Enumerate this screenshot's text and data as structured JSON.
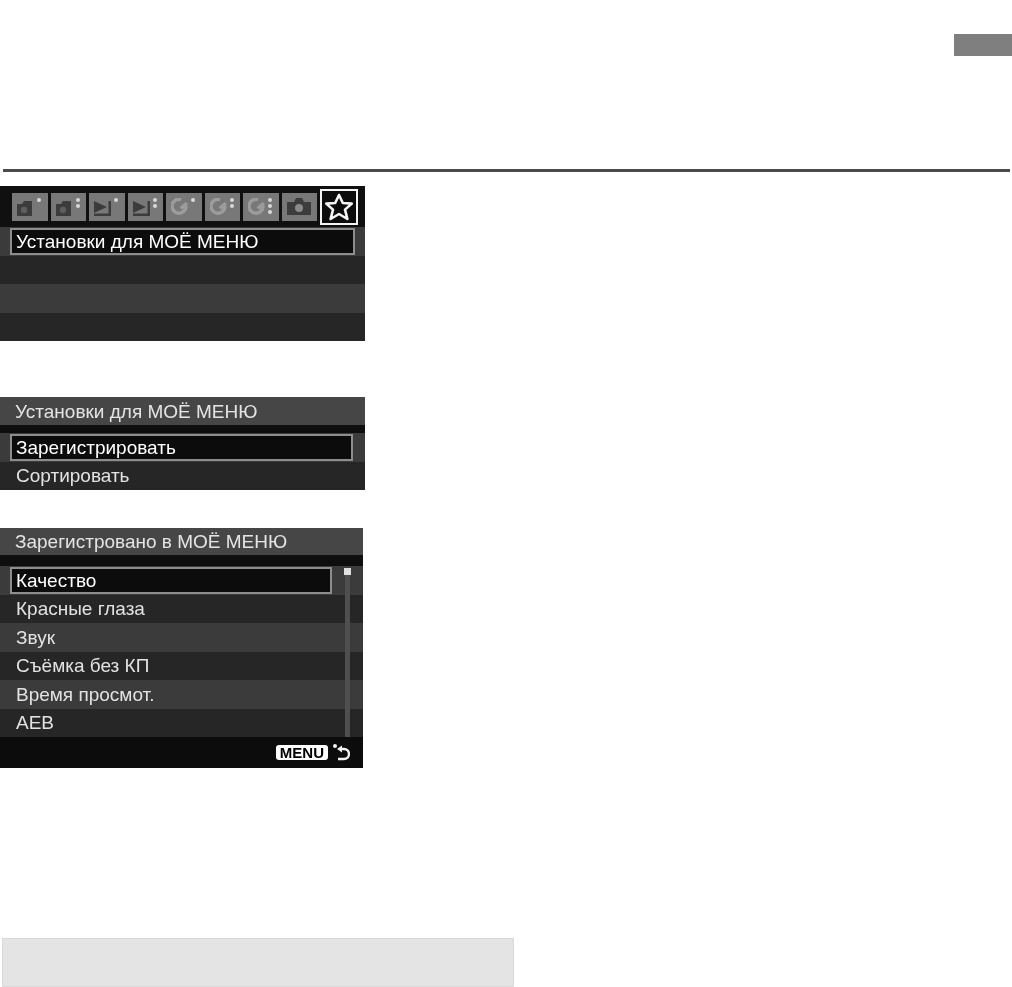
{
  "screens": [
    {
      "kind": "tabbed",
      "tabs": [
        {
          "kind": "shoot1",
          "selected": false
        },
        {
          "kind": "shoot2",
          "selected": false
        },
        {
          "kind": "play1",
          "selected": false
        },
        {
          "kind": "play2",
          "selected": false
        },
        {
          "kind": "setup1",
          "selected": false
        },
        {
          "kind": "setup2",
          "selected": false
        },
        {
          "kind": "setup3",
          "selected": false
        },
        {
          "kind": "custom",
          "selected": false
        },
        {
          "kind": "mymenu",
          "selected": true
        }
      ],
      "items": [
        {
          "label": "Установки для МОЁ МЕНЮ",
          "selected": true
        }
      ]
    },
    {
      "kind": "submenu",
      "title": "Установки для МОЁ МЕНЮ",
      "items": [
        {
          "label": "Зарегистрировать",
          "selected": true
        },
        {
          "label": "Сортировать",
          "selected": false
        }
      ]
    },
    {
      "kind": "list",
      "title": "Зарегистровано в МОЁ МЕНЮ",
      "items": [
        {
          "label": "Качество",
          "selected": true
        },
        {
          "label": "Красные глаза",
          "selected": false
        },
        {
          "label": "Звук",
          "selected": false
        },
        {
          "label": "Съёмка без КП",
          "selected": false
        },
        {
          "label": "Время просмот.",
          "selected": false
        },
        {
          "label": "AEB",
          "selected": false
        }
      ],
      "footer_key": "MENU"
    }
  ]
}
